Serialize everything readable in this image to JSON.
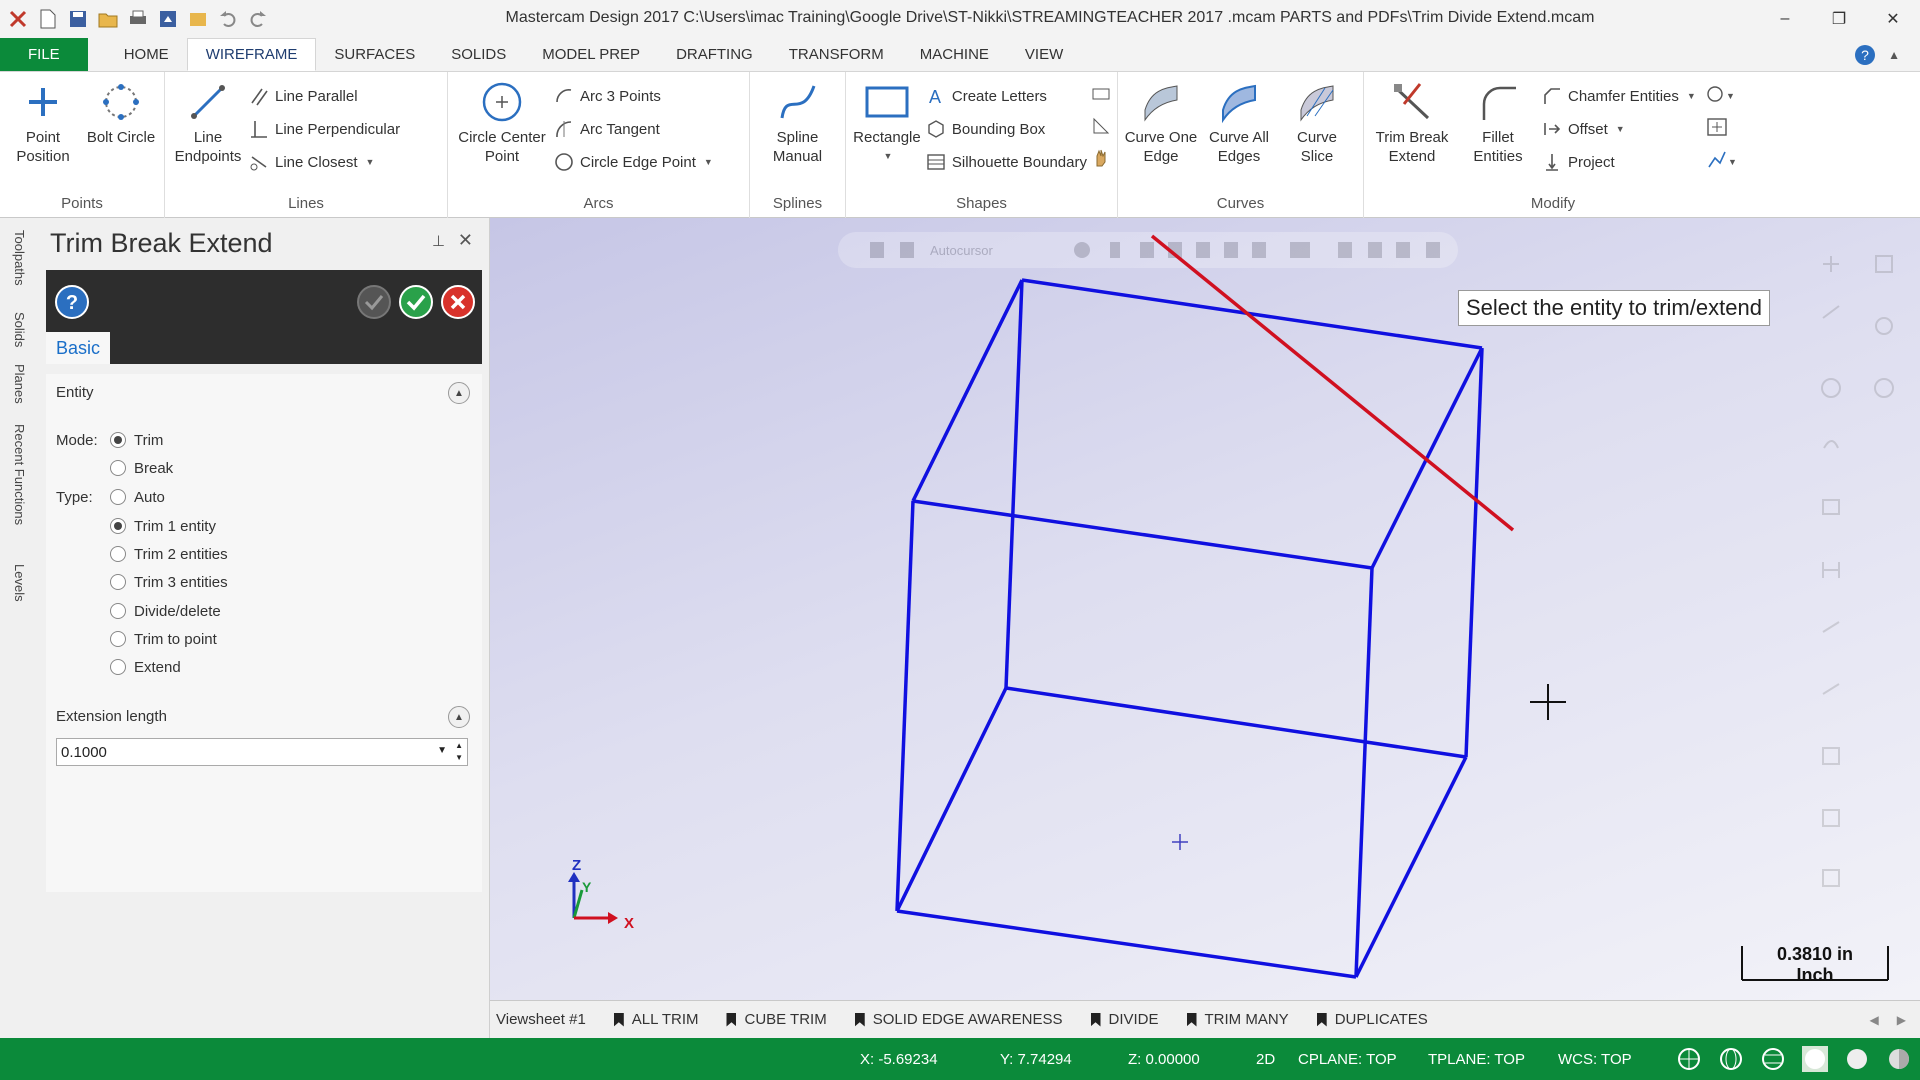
{
  "window": {
    "title": "Mastercam Design 2017  C:\\Users\\imac Training\\Google Drive\\ST-Nikki\\STREAMINGTEACHER 2017 .mcam PARTS and PDFs\\Trim Divide Extend.mcam"
  },
  "tabs": [
    "FILE",
    "HOME",
    "WIREFRAME",
    "SURFACES",
    "SOLIDS",
    "MODEL PREP",
    "DRAFTING",
    "TRANSFORM",
    "MACHINE",
    "VIEW"
  ],
  "ribbon": {
    "points": {
      "label": "Points",
      "point_position": "Point Position",
      "bolt_circle": "Bolt Circle"
    },
    "lines": {
      "label": "Lines",
      "line_endpoints": "Line Endpoints",
      "line_parallel": "Line Parallel",
      "line_perpendicular": "Line Perpendicular",
      "line_closest": "Line Closest"
    },
    "arcs": {
      "label": "Arcs",
      "circle_center_point": "Circle Center Point",
      "arc_3_points": "Arc 3 Points",
      "arc_tangent": "Arc Tangent",
      "circle_edge_point": "Circle Edge Point"
    },
    "splines": {
      "label": "Splines",
      "spline_manual": "Spline Manual"
    },
    "shapes": {
      "label": "Shapes",
      "rectangle": "Rectangle",
      "create_letters": "Create Letters",
      "bounding_box": "Bounding Box",
      "silhouette_boundary": "Silhouette Boundary"
    },
    "curves": {
      "label": "Curves",
      "curve_one_edge": "Curve One Edge",
      "curve_all_edges": "Curve All Edges",
      "curve_slice": "Curve Slice"
    },
    "modify": {
      "label": "Modify",
      "trim_break_extend": "Trim Break Extend",
      "fillet_entities": "Fillet Entities",
      "chamfer_entities": "Chamfer Entities",
      "offset": "Offset",
      "project": "Project"
    }
  },
  "managers": [
    "Toolpaths",
    "Solids",
    "Planes",
    "Recent Functions",
    "Levels"
  ],
  "panel": {
    "title": "Trim Break Extend",
    "tab_basic": "Basic",
    "entity_header": "Entity",
    "mode_label": "Mode:",
    "mode_trim": "Trim",
    "mode_break": "Break",
    "type_label": "Type:",
    "type_auto": "Auto",
    "type_trim1": "Trim 1 entity",
    "type_trim2": "Trim 2 entities",
    "type_trim3": "Trim 3 entities",
    "type_divide": "Divide/delete",
    "type_trim_point": "Trim to point",
    "type_extend": "Extend",
    "extension_header": "Extension length",
    "extension_value": "0.1000"
  },
  "viewport": {
    "prompt": "Select the entity to trim/extend",
    "scale_value": "0.3810 in",
    "scale_unit": "Inch",
    "axis_z": "Z",
    "axis_y": "Y",
    "axis_x": "X",
    "toolbar_text": "Autocursor"
  },
  "viewsheets": [
    "Viewsheet #1",
    "ALL TRIM",
    "CUBE TRIM",
    "SOLID EDGE AWARENESS",
    "DIVIDE",
    "TRIM MANY",
    "DUPLICATES"
  ],
  "status": {
    "x": "X:  -5.69234",
    "y": "Y:  7.74294",
    "z": "Z:  0.00000",
    "mode": "2D",
    "cplane": "CPLANE: TOP",
    "tplane": "TPLANE: TOP",
    "wcs": "WCS: TOP"
  },
  "colors": {
    "accent_green": "#0b8a3a",
    "wire_blue": "#1010e0",
    "wire_red": "#d01020"
  }
}
